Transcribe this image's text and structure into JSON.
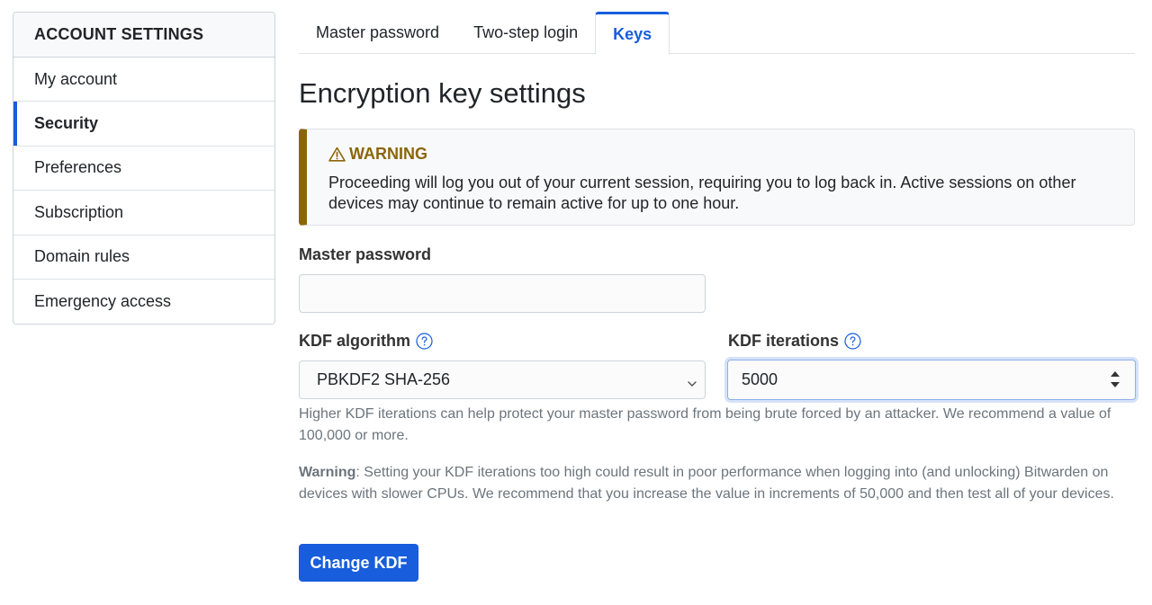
{
  "sidebar": {
    "header": "ACCOUNT SETTINGS",
    "items": [
      {
        "label": "My account"
      },
      {
        "label": "Security"
      },
      {
        "label": "Preferences"
      },
      {
        "label": "Subscription"
      },
      {
        "label": "Domain rules"
      },
      {
        "label": "Emergency access"
      }
    ],
    "active_index": 1
  },
  "tabs": [
    {
      "label": "Master password"
    },
    {
      "label": "Two-step login"
    },
    {
      "label": "Keys"
    }
  ],
  "active_tab": 2,
  "page_title": "Encryption key settings",
  "warning": {
    "title": "WARNING",
    "text": "Proceeding will log you out of your current session, requiring you to log back in. Active sessions on other devices may continue to remain active for up to one hour."
  },
  "form": {
    "master_password_label": "Master password",
    "master_password_value": "",
    "kdf_algorithm_label": "KDF algorithm",
    "kdf_algorithm_value": "PBKDF2 SHA-256",
    "kdf_iterations_label": "KDF iterations",
    "kdf_iterations_value": "5000",
    "hint": "Higher KDF iterations can help protect your master password from being brute forced by an attacker. We recommend a value of 100,000 or more.",
    "warning_label": "Warning",
    "warning_text": ": Setting your KDF iterations too high could result in poor performance when logging into (and unlocking) Bitwarden on devices with slower CPUs. We recommend that you increase the value in increments of 50,000 and then test all of your devices.",
    "submit_label": "Change KDF"
  },
  "colors": {
    "accent": "#175ddc",
    "warning": "#8b6609",
    "muted": "#6c757d"
  }
}
